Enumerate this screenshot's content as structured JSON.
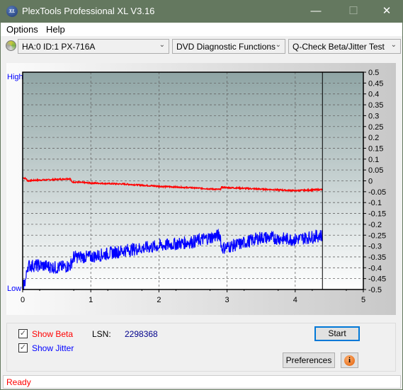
{
  "window": {
    "title": "PlexTools Professional XL V3.16",
    "logo_text": "XL",
    "controls": {
      "minimize": "—",
      "maximize": "☐",
      "close": "✕"
    }
  },
  "menu": [
    {
      "label": "Options"
    },
    {
      "label": "Help"
    }
  ],
  "toolbar": {
    "drive": "HA:0 ID:1  PX-716A",
    "function": "DVD Diagnostic Functions",
    "test": "Q-Check Beta/Jitter Test"
  },
  "chart_data": {
    "type": "line",
    "xlim": [
      0,
      5
    ],
    "ylim": [
      -0.5,
      0.5
    ],
    "x_ticks": [
      "0",
      "1",
      "2",
      "3",
      "4",
      "5"
    ],
    "y_ticks": [
      "0.5",
      "0.45",
      "0.4",
      "0.35",
      "0.3",
      "0.25",
      "0.2",
      "0.15",
      "0.1",
      "0.05",
      "0",
      "-0.05",
      "-0.1",
      "-0.15",
      "-0.2",
      "-0.25",
      "-0.3",
      "-0.35",
      "-0.4",
      "-0.45",
      "-0.5"
    ],
    "left_labels": {
      "high": "High",
      "low": "Low"
    },
    "grid": true,
    "marker_x": 4.4,
    "series": [
      {
        "key": "beta",
        "color": "#ff0000",
        "points": [
          [
            0,
            0.015
          ],
          [
            0.05,
            0.01
          ],
          [
            0.07,
            0
          ],
          [
            0.2,
            0.003
          ],
          [
            0.4,
            0.005
          ],
          [
            0.7,
            0.01
          ],
          [
            0.72,
            -0.005
          ],
          [
            1,
            -0.01
          ],
          [
            1.5,
            -0.015
          ],
          [
            2,
            -0.025
          ],
          [
            2.5,
            -0.032
          ],
          [
            2.9,
            -0.04
          ],
          [
            2.92,
            -0.03
          ],
          [
            3.5,
            -0.038
          ],
          [
            4,
            -0.045
          ],
          [
            4.4,
            -0.04
          ]
        ]
      },
      {
        "key": "jitter",
        "color": "#0000ff",
        "points": [
          [
            0,
            -0.49
          ],
          [
            0.05,
            -0.45
          ],
          [
            0.07,
            -0.39
          ],
          [
            0.3,
            -0.39
          ],
          [
            0.5,
            -0.4
          ],
          [
            0.7,
            -0.39
          ],
          [
            0.75,
            -0.35
          ],
          [
            1,
            -0.35
          ],
          [
            1.5,
            -0.32
          ],
          [
            2,
            -0.3
          ],
          [
            2.5,
            -0.28
          ],
          [
            2.9,
            -0.25
          ],
          [
            2.92,
            -0.31
          ],
          [
            3.2,
            -0.29
          ],
          [
            3.5,
            -0.26
          ],
          [
            4,
            -0.27
          ],
          [
            4.4,
            -0.25
          ]
        ]
      }
    ]
  },
  "controls": {
    "show_beta": "Show Beta",
    "show_jitter": "Show Jitter",
    "show_beta_checked": true,
    "show_jitter_checked": true,
    "lsn_label": "LSN:",
    "lsn_value": "2298368",
    "start": "Start",
    "preferences": "Preferences",
    "info_icon": "i"
  },
  "status": "Ready"
}
